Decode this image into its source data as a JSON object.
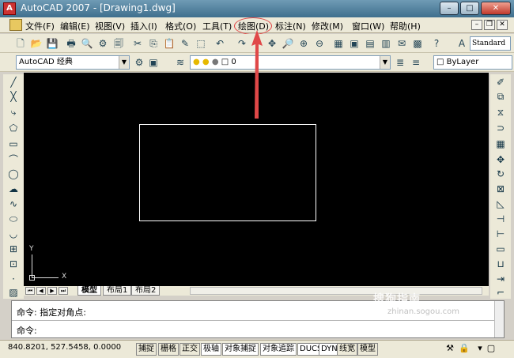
{
  "window": {
    "title": "AutoCAD 2007 - [Drawing1.dwg]",
    "minimize": "–",
    "maximize": "□",
    "close": "✕"
  },
  "menu": {
    "items": [
      {
        "label": "文件(F)"
      },
      {
        "label": "编辑(E)"
      },
      {
        "label": "视图(V)"
      },
      {
        "label": "插入(I)"
      },
      {
        "label": "格式(O)"
      },
      {
        "label": "工具(T)"
      },
      {
        "label": "绘图(D)"
      },
      {
        "label": "标注(N)"
      },
      {
        "label": "修改(M)"
      },
      {
        "label": "窗口(W)"
      },
      {
        "label": "帮助(H)"
      }
    ],
    "highlighted": "绘图(D)"
  },
  "toolbar": {
    "text_style": "Standard",
    "workspace": "AutoCAD 经典",
    "layer": "0",
    "color": "ByLayer"
  },
  "canvas": {
    "background": "#000000",
    "ucs_y": "Y",
    "ucs_x": "X"
  },
  "tabs": [
    {
      "label": "模型",
      "active": true
    },
    {
      "label": "布局1",
      "active": false
    },
    {
      "label": "布局2",
      "active": false
    }
  ],
  "command": {
    "history": "命令: 指定对角点:",
    "prompt": "命令:"
  },
  "watermark": {
    "text": "搜狗指南",
    "sub": "zhinan.sogou.com"
  },
  "status": {
    "coords": "840.8201,  527.5458, 0.0000",
    "buttons": [
      "捕捉",
      "栅格",
      "正交",
      "极轴",
      "对象捕捉",
      "对象追踪",
      "DUCS",
      "DYN",
      "线宽",
      "模型"
    ]
  },
  "colors": {
    "annotation": "#e04848"
  }
}
